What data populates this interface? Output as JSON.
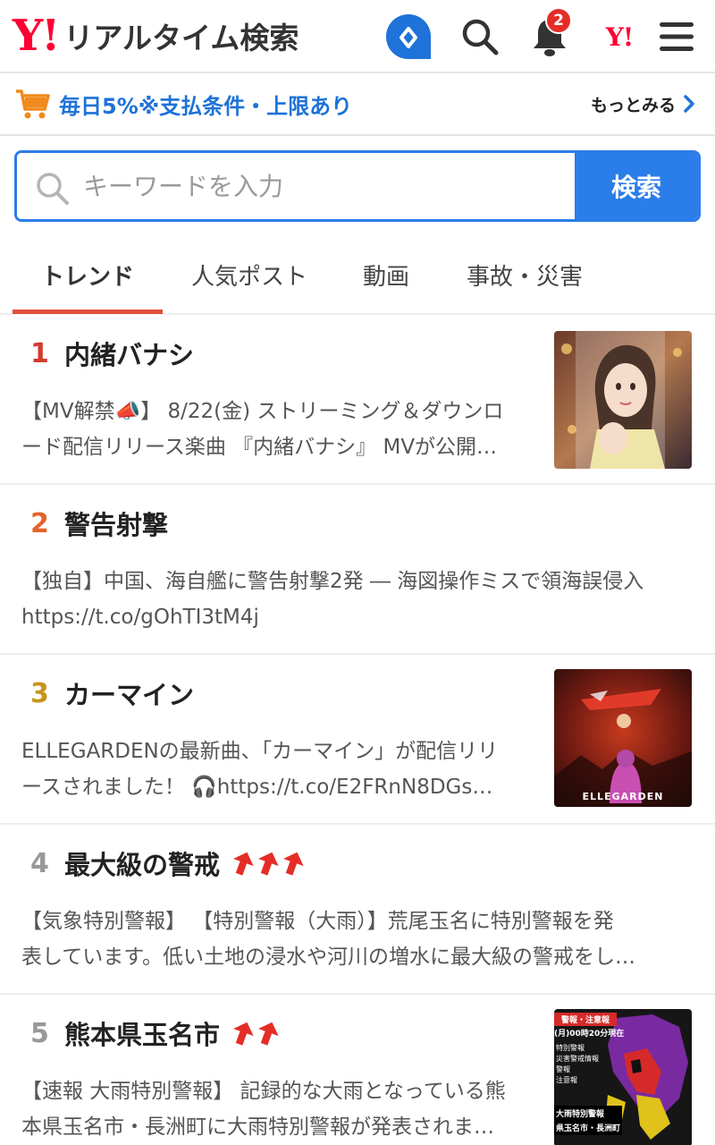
{
  "header": {
    "logo_mark": "Y!",
    "logo_text": "リアルタイム検索",
    "notification_count": "2",
    "yj_mark": "Y!"
  },
  "promo": {
    "text": "毎日5%※支払条件・上限あり",
    "more_label": "もっとみる"
  },
  "search": {
    "placeholder": "キーワードを入力",
    "button_label": "検索"
  },
  "tabs": [
    {
      "label": "トレンド",
      "active": true
    },
    {
      "label": "人気ポスト",
      "active": false
    },
    {
      "label": "動画",
      "active": false
    },
    {
      "label": "事故・災害",
      "active": false
    }
  ],
  "trends": [
    {
      "rank": "1",
      "rank_color": "#d33b2f",
      "title": "内緒バナシ",
      "arrows": 0,
      "line1": "【MV解禁📣】 8/22(金) ストリーミング＆ダウンロ",
      "line2": "ード配信リリース楽曲 『内緒バナシ』 MVが公開…",
      "thumb_icon": "music-video-thumbnail"
    },
    {
      "rank": "2",
      "rank_color": "#e4632b",
      "title": "警告射撃",
      "arrows": 0,
      "line1": "【独自】中国、海自艦に警告射撃2発 ― 海図操作ミスで領海誤侵入",
      "line2": "https://t.co/gOhTI3tM4j",
      "thumb_icon": ""
    },
    {
      "rank": "3",
      "rank_color": "#c7951d",
      "title": "カーマイン",
      "arrows": 0,
      "line1": "ELLEGARDENの最新曲、「カーマイン」が配信リリ",
      "line2": "ースされました！ 🎧https://t.co/E2FRnN8DGs…",
      "thumb_icon": "album-art-thumbnail",
      "thumb_text": "ELLEGARDEN"
    },
    {
      "rank": "4",
      "rank_color": "#999999",
      "title": "最大級の警戒",
      "arrows": 3,
      "line1": "【気象特別警報】 【特別警報（大雨）】荒尾玉名に特別警報を発",
      "line2": "表しています。低い土地の浸水や河川の増水に最大級の警戒をし…",
      "thumb_icon": ""
    },
    {
      "rank": "5",
      "rank_color": "#999999",
      "title": "熊本県玉名市",
      "arrows": 2,
      "line1": "【速報 大雨特別警報】 記録的な大雨となっている熊",
      "line2": "本県玉名市・長洲町に大雨特別警報が発表されま…",
      "thumb_icon": "weather-warning-map-thumbnail",
      "thumb_header": "警報・注意報",
      "thumb_time": "(月)00時20分現在",
      "thumb_legend": [
        "特別警報",
        "災害警戒情報",
        "警報",
        "注意報"
      ],
      "thumb_footer1": "大雨特別警報",
      "thumb_footer2": "県玉名市・長洲町"
    }
  ],
  "colors": {
    "accent_blue": "#2b7de9",
    "brand_red": "#ff0033",
    "trend_arrow": "#e52d27",
    "tab_underline": "#e0503c"
  }
}
